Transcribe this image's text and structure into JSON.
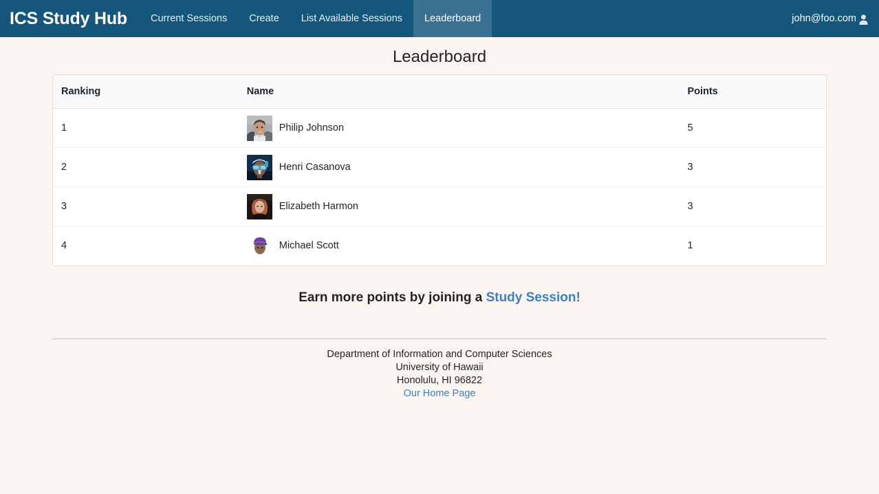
{
  "theme": {
    "navbar_bg": "#14567c",
    "navbar_active_bg": "#3a7193",
    "page_bg": "#fbf5f1",
    "link_color": "#3b7fc4",
    "card_bg": "#ffffff",
    "table_head_bg": "#f8f9fa",
    "text_color": "#212529"
  },
  "navbar": {
    "brand": "ICS Study Hub",
    "items": [
      {
        "label": "Current Sessions",
        "active": false
      },
      {
        "label": "Create",
        "active": false
      },
      {
        "label": "List Available Sessions",
        "active": false
      },
      {
        "label": "Leaderboard",
        "active": true
      }
    ],
    "user": {
      "email": "john@foo.com",
      "icon": "user-person-icon"
    }
  },
  "page": {
    "title": "Leaderboard"
  },
  "table": {
    "columns": [
      "Ranking",
      "Name",
      "Points"
    ],
    "rows": [
      {
        "ranking": "1",
        "name": "Philip Johnson",
        "points": "5",
        "avatar": "philip-johnson-avatar"
      },
      {
        "ranking": "2",
        "name": "Henri Casanova",
        "points": "3",
        "avatar": "henri-casanova-avatar"
      },
      {
        "ranking": "3",
        "name": "Elizabeth Harmon",
        "points": "3",
        "avatar": "elizabeth-harmon-avatar"
      },
      {
        "ranking": "4",
        "name": "Michael Scott",
        "points": "1",
        "avatar": "michael-scott-avatar"
      }
    ]
  },
  "cta": {
    "prefix": "Earn more points by joining a ",
    "link": "Study Session!"
  },
  "footer": {
    "line1": "Department of Information and Computer Sciences",
    "line2": "University of Hawaii",
    "line3": "Honolulu, HI 96822",
    "link": "Our Home Page"
  }
}
